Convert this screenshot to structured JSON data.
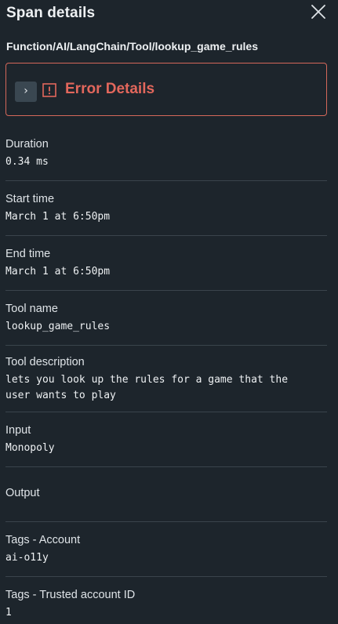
{
  "header": {
    "title": "Span details",
    "close_icon": "close-icon"
  },
  "span_name": "Function/AI/LangChain/Tool/lookup_game_rules",
  "error": {
    "title": "Error Details",
    "expand_glyph": "›",
    "accent_color": "#e2675c"
  },
  "fields": [
    {
      "label": "Duration",
      "value": "0.34 ms"
    },
    {
      "label": "Start time",
      "value": "March 1 at 6:50pm"
    },
    {
      "label": "End time",
      "value": "March 1 at 6:50pm"
    },
    {
      "label": "Tool name",
      "value": "lookup_game_rules"
    },
    {
      "label": "Tool description",
      "value": "lets you look up the rules for a game that the user wants to play"
    },
    {
      "label": "Input",
      "value": "Monopoly"
    },
    {
      "label": "Output",
      "value": ""
    },
    {
      "label": "Tags - Account",
      "value": "ai-o11y"
    },
    {
      "label": "Tags - Trusted account ID",
      "value": "1"
    }
  ]
}
